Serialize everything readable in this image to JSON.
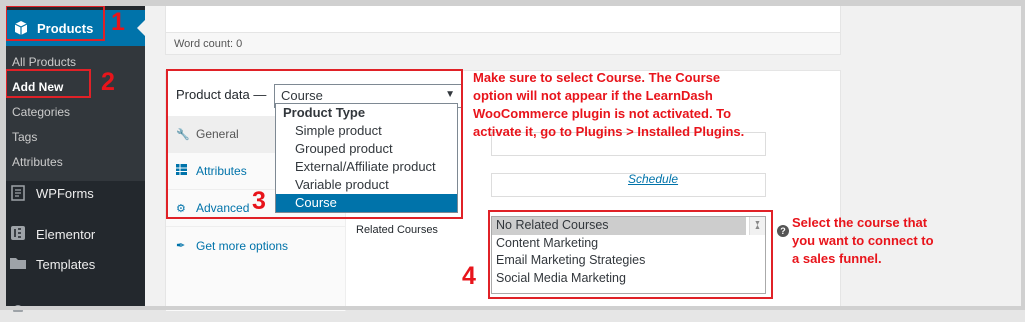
{
  "sidebar": {
    "products_label": "Products",
    "submenu": [
      "All Products",
      "Add New",
      "Categories",
      "Tags",
      "Attributes"
    ],
    "menu_items": [
      {
        "label": "WPForms",
        "icon": "form-icon"
      },
      {
        "label": "Elementor",
        "icon": "elementor-icon"
      },
      {
        "label": "Templates",
        "icon": "folder-icon"
      }
    ]
  },
  "editor": {
    "word_count": "Word count: 0"
  },
  "product_data": {
    "label": "Product data —",
    "selected": "Course",
    "tabs": [
      {
        "label": "General",
        "icon": "wrench-icon"
      },
      {
        "label": "Attributes",
        "icon": "table-icon"
      },
      {
        "label": "Advanced",
        "icon": "gear-icon"
      },
      {
        "label": "Get more options",
        "icon": "plugin-icon"
      }
    ],
    "dropdown": {
      "group": "Product Type",
      "options": [
        "Simple product",
        "Grouped product",
        "External/Affiliate product",
        "Variable product",
        "Course"
      ]
    },
    "schedule_link": "Schedule",
    "related_courses_label": "Related Courses",
    "related_courses": [
      "No Related Courses",
      "Content Marketing",
      "Email Marketing Strategies",
      "Social Media Marketing"
    ],
    "help_icon": "?"
  },
  "annotations": {
    "num1": "1",
    "num2": "2",
    "num3": "3",
    "num4": "4",
    "note_top": [
      "Make sure to select Course. The Course",
      "option will not appear if the LearnDash",
      "WooCommerce plugin is not activated. To",
      "activate it, go to Plugins > Installed Plugins."
    ],
    "note_right": [
      "Select the course that",
      "you want to connect to",
      "a sales funnel."
    ]
  },
  "colors": {
    "accent": "#0073aa",
    "annotation": "#e8141b",
    "sidebar": "#23282d"
  }
}
